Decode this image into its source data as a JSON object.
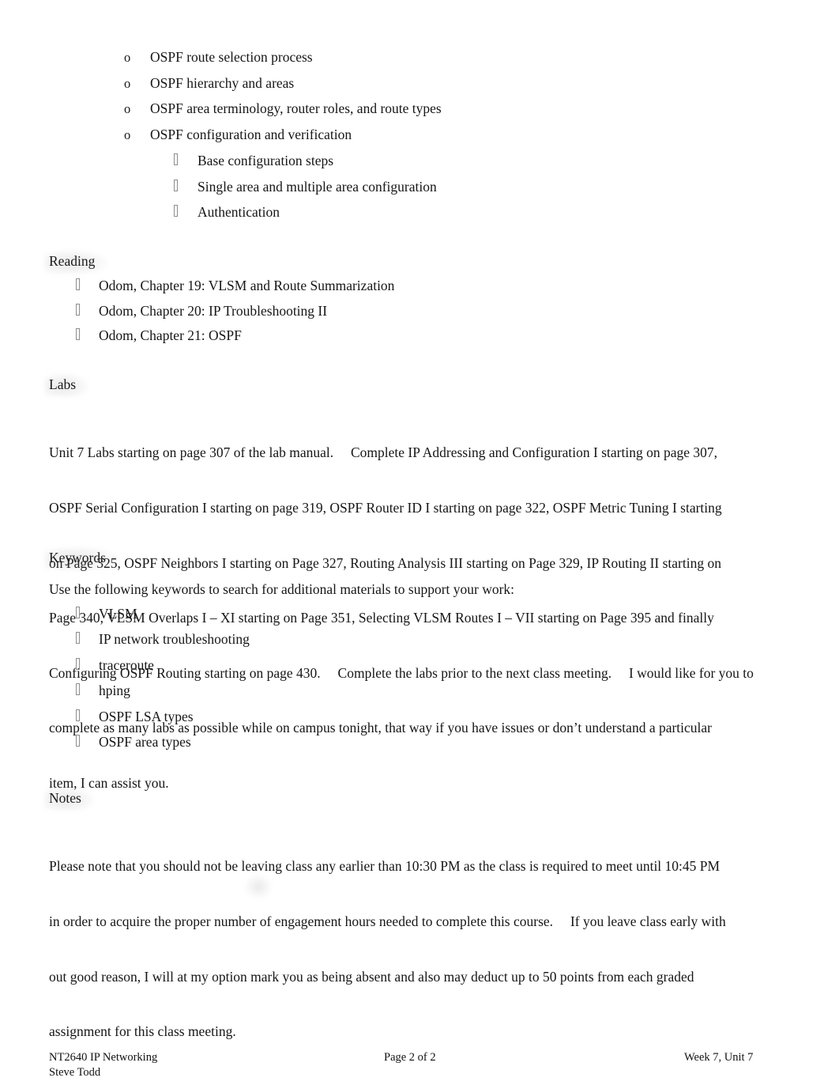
{
  "document": {
    "bullet_glyphs": {
      "level2": "o",
      "level3": "missing-glyph-box",
      "list": "missing-glyph-box"
    },
    "topic_list": {
      "level2_items": [
        "OSPF route selection process",
        "OSPF hierarchy and areas",
        "OSPF area terminology, router roles, and route types",
        "OSPF configuration and verification"
      ],
      "level3_items": [
        "Base configuration steps",
        "Single area and multiple area configuration",
        "Authentication"
      ]
    },
    "reading": {
      "heading": "Reading",
      "items": [
        "Odom, Chapter 19: VLSM and Route Summarization",
        "Odom, Chapter 20: IP Troubleshooting II",
        "Odom, Chapter 21: OSPF"
      ]
    },
    "labs": {
      "heading": "Labs",
      "lines": [
        "Unit 7 Labs starting on page 307 of the lab manual.  Complete IP Addressing and Configuration I starting on page 307,",
        "OSPF Serial Configuration I starting on page 319, OSPF Router ID I starting on page 322, OSPF Metric Tuning I starting",
        "on Page 325, OSPF Neighbors I starting on Page 327, Routing Analysis III starting on Page 329, IP Routing II starting on",
        "Page 340, VLSM Overlaps I – XI starting on Page 351, Selecting VLSM Routes I – VII starting on Page 395 and finally",
        "Configuring OSPF Routing starting on page 430.  Complete the labs prior to the next class meeting.  I would like for you to",
        "complete as many labs as possible while on campus tonight, that way if you have issues or don’t understand a particular",
        "item, I can assist you."
      ]
    },
    "keywords": {
      "heading": "Keywords",
      "intro": "Use the following keywords to search for additional materials to support your work:",
      "items": [
        "VLSM",
        "IP network troubleshooting",
        "traceroute",
        "hping",
        "OSPF LSA types",
        "OSPF area types"
      ]
    },
    "notes": {
      "heading": "Notes",
      "lines": [
        "Please note that you should not be leaving class any earlier than 10:30 PM as the class is required to meet until 10:45 PM",
        "in order to acquire the proper number of engagement hours needed to complete this course.  If you leave class early with",
        "out good reason, I will at my option mark you as being absent and also may deduct up to 50 points from each graded",
        "assignment for this class meeting."
      ]
    },
    "footer": {
      "course": "NT2640 IP Networking",
      "author": "Steve Todd",
      "page": "Page 2 of 2",
      "week": "Week 7, Unit 7"
    }
  }
}
